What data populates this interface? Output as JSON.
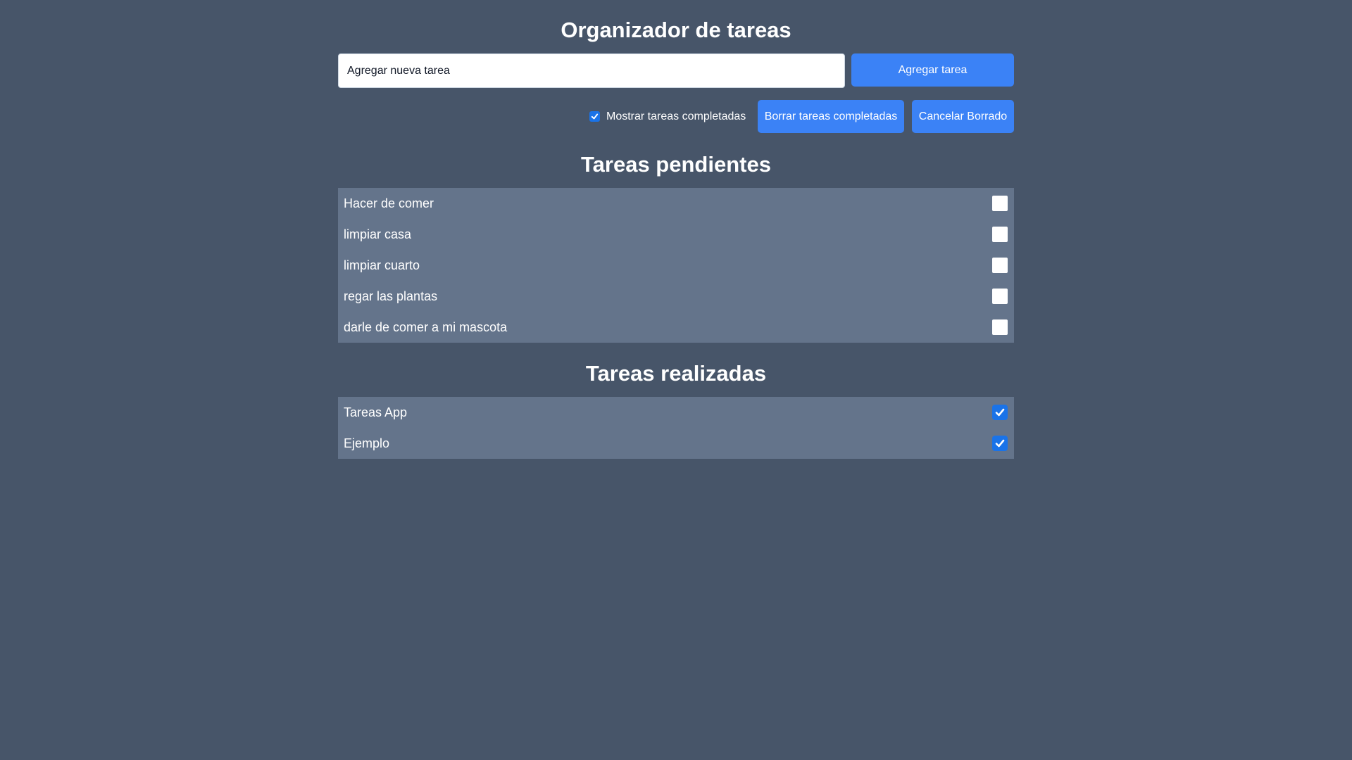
{
  "app": {
    "title": "Organizador de tareas"
  },
  "add_form": {
    "input_value": "Agregar nueva tarea",
    "add_button_label": "Agregar tarea"
  },
  "controls": {
    "show_completed_label": "Mostrar tareas completadas",
    "show_completed_checked": true,
    "delete_completed_label": "Borrar tareas completadas",
    "cancel_delete_label": "Cancelar Borrado"
  },
  "pending": {
    "title": "Tareas pendientes",
    "items": [
      {
        "label": "Hacer de comer",
        "done": false
      },
      {
        "label": "limpiar casa",
        "done": false
      },
      {
        "label": "limpiar cuarto",
        "done": false
      },
      {
        "label": "regar las plantas",
        "done": false
      },
      {
        "label": "darle de comer a mi mascota",
        "done": false
      }
    ]
  },
  "done": {
    "title": "Tareas realizadas",
    "items": [
      {
        "label": "Tareas App",
        "done": true
      },
      {
        "label": "Ejemplo",
        "done": true
      }
    ]
  },
  "colors": {
    "background": "#475569",
    "list_background": "#64748b",
    "accent": "#3b82f6",
    "checkbox_checked": "#1a73e8"
  },
  "icons": {
    "checkmark": "check-icon"
  }
}
